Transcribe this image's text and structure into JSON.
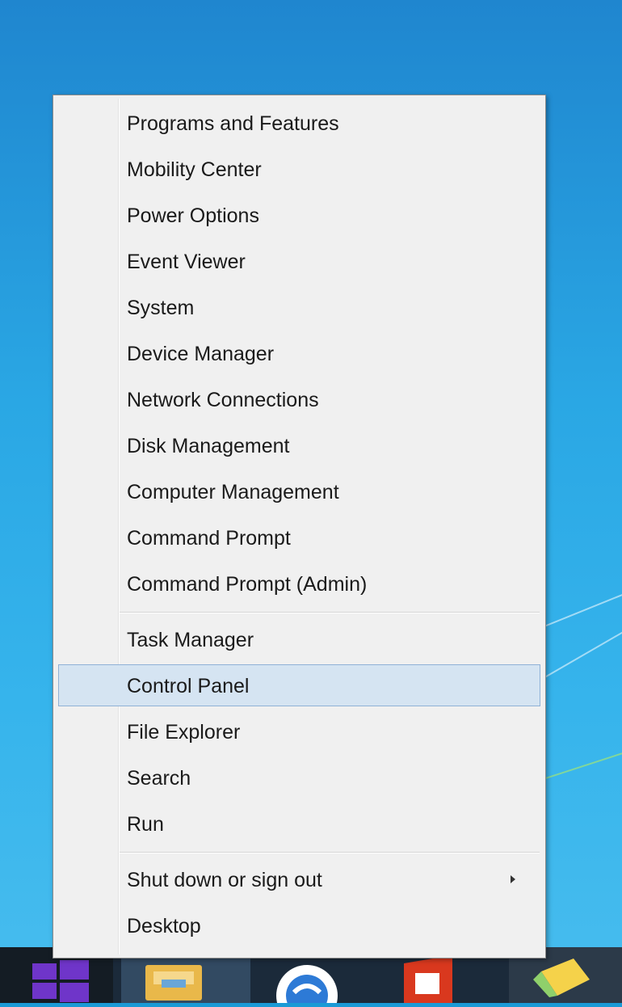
{
  "menu": {
    "groups": [
      {
        "items": [
          {
            "label": "Programs and Features"
          },
          {
            "label": "Mobility Center"
          },
          {
            "label": "Power Options"
          },
          {
            "label": "Event Viewer"
          },
          {
            "label": "System"
          },
          {
            "label": "Device Manager"
          },
          {
            "label": "Network Connections"
          },
          {
            "label": "Disk Management"
          },
          {
            "label": "Computer Management"
          },
          {
            "label": "Command Prompt"
          },
          {
            "label": "Command Prompt (Admin)"
          }
        ]
      },
      {
        "items": [
          {
            "label": "Task Manager"
          },
          {
            "label": "Control Panel",
            "selected": true
          },
          {
            "label": "File Explorer"
          },
          {
            "label": "Search"
          },
          {
            "label": "Run"
          }
        ]
      },
      {
        "items": [
          {
            "label": "Shut down or sign out",
            "submenu": true
          },
          {
            "label": "Desktop"
          }
        ]
      }
    ]
  },
  "colors": {
    "selected_bg": "#d5e4f2",
    "selected_border": "#8fb1d6",
    "start_logo": "#6f35c9"
  },
  "taskbar": {
    "items": [
      "file-explorer-icon",
      "chrome-icon",
      "office-icon",
      "sticky-notes-icon"
    ]
  }
}
